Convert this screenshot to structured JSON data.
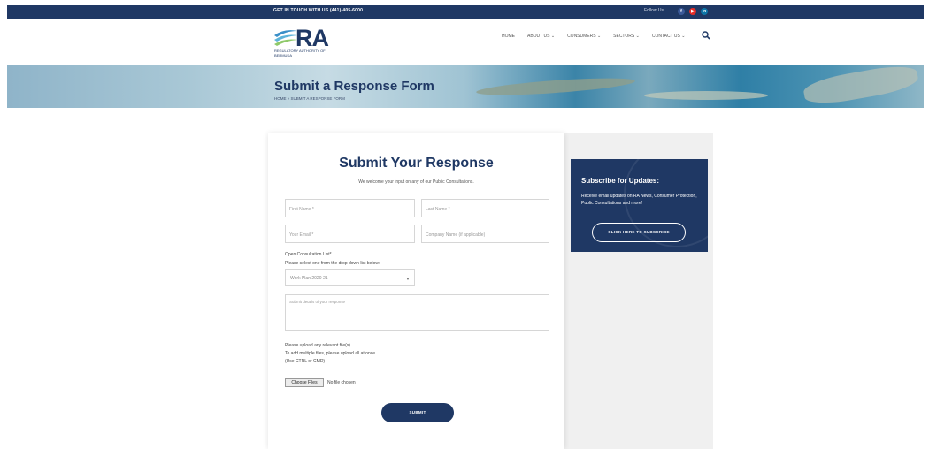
{
  "topbar": {
    "contact": "GET IN TOUCH WITH US  (441)-405-6000",
    "follow": "Follow Us:",
    "social": [
      {
        "icon": "facebook-icon",
        "glyph": "f",
        "color": "#3b5998"
      },
      {
        "icon": "youtube-icon",
        "glyph": "▶",
        "color": "#e52d27"
      },
      {
        "icon": "linkedin-icon",
        "glyph": "in",
        "color": "#0e76a8"
      }
    ]
  },
  "header": {
    "logo_text": "RA",
    "logo_tagline": "REGULATORY AUTHORITY OF BERMUDA",
    "nav": [
      "HOME",
      "ABOUT US ⌄",
      "CONSUMERS ⌄",
      "SECTORS ⌄",
      "CONTACT US ⌄"
    ]
  },
  "banner": {
    "title": "Submit a Response Form",
    "breadcrumb": "HOME  »  SUBMIT A RESPONSE FORM"
  },
  "form": {
    "heading": "Submit Your Response",
    "subheading": "We welcome your input on any of our Public Consultations.",
    "first_name_placeholder": "First Name *",
    "last_name_placeholder": "Last Name *",
    "email_placeholder": "Your Email *",
    "company_placeholder": "Company Name (if applicable)",
    "consultation_label": "Open Consultation List*",
    "consultation_help": "Please select one from the drop down list below:",
    "consultation_selected": "Work Plan 2020-21",
    "details_placeholder": "Submit details of your response",
    "upload_line1": "Please upload any relevant file(s).",
    "upload_line2": "To add multiple files, please upload all at once.",
    "upload_line3": "(Use CTRL or CMD)",
    "choose_files": "Choose Files",
    "no_file": "No file chosen",
    "submit": "SUBMIT"
  },
  "subscribe": {
    "title": "Subscribe for Updates:",
    "text": "Receive email updates on RA News, Consumer Protection, Public Consultations and more!",
    "button": "CLICK HERE TO SUBSCRIBE"
  },
  "colors": {
    "primary": "#1f3864"
  }
}
